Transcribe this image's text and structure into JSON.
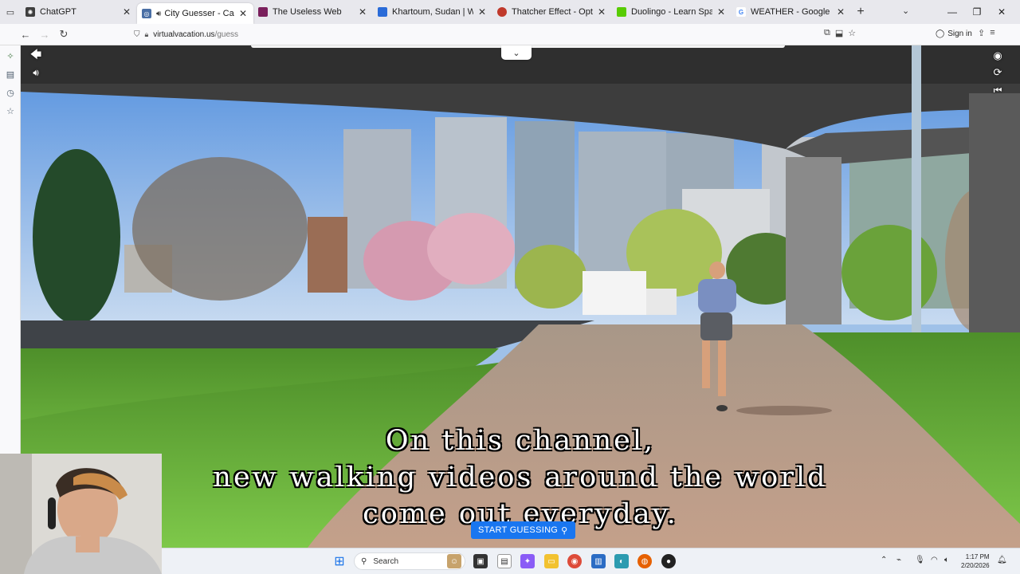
{
  "browser": {
    "tabs": [
      {
        "title": "ChatGPT",
        "favicon_color": "#3f3f3f",
        "active": false
      },
      {
        "title": "City Guesser - Can you gue",
        "favicon_color": "#4a6fa5",
        "active": true,
        "audio": true
      },
      {
        "title": "The Useless Web",
        "favicon_color": "#7a1f5c",
        "active": false
      },
      {
        "title": "Khartoum, Sudan | Weather Sat",
        "favicon_color": "#2a6bd8",
        "active": false
      },
      {
        "title": "Thatcher Effect - Optical Illusio",
        "favicon_color": "#c0392b",
        "active": false
      },
      {
        "title": "Duolingo - Learn Spanish with I",
        "favicon_color": "#58cc02",
        "active": false
      },
      {
        "title": "WEATHER - Google Search",
        "favicon_color": "#4285f4",
        "active": false
      }
    ],
    "url_host": "virtualvacation.us",
    "url_path": "/guess",
    "sign_in_label": "Sign in"
  },
  "game": {
    "subtitle_lines": [
      "On this channel,",
      "new walking videos around the world",
      "come out everyday."
    ],
    "start_button_label": "START GUESSING",
    "start_button_color": "#1976f0"
  },
  "taskbar": {
    "search_label": "Search",
    "time": "1:17 PM",
    "date": "2/20/2026"
  }
}
